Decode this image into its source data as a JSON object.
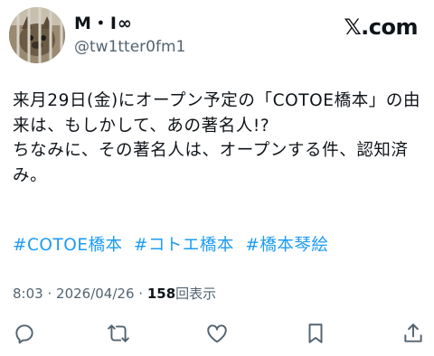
{
  "header": {
    "display_name": "M・I∞",
    "handle": "@tw1tter0fm1",
    "brand": "𝕏.com"
  },
  "tweet": {
    "text": "来月29日(金)にオープン予定の「COTOE橋本」の由来は、もしかして、あの著名人!?\nちなみに、その著名人は、オープンする件、認知済み。",
    "hashtags": [
      "#COTOE橋本",
      "#コトエ橋本",
      "#橋本琴絵"
    ]
  },
  "meta": {
    "time": "8:03",
    "separator": "·",
    "date": "2026/04/26",
    "views_count": "158",
    "views_label": "回表示"
  },
  "actions": {
    "reply_icon": "reply-icon",
    "retweet_icon": "retweet-icon",
    "like_icon": "like-icon",
    "bookmark_icon": "bookmark-icon",
    "share_icon": "share-icon"
  }
}
